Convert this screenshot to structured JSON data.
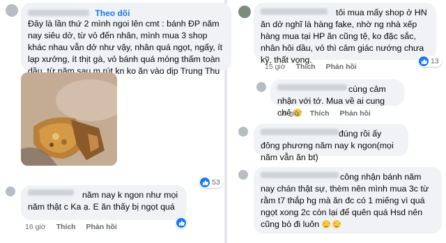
{
  "left": {
    "comment1": {
      "follow_label": "Theo dõi",
      "text": "Đây là lần thứ 2 mình ngoi lên cmt : bánh ĐP năm nay siêu dở, từ vỏ đến nhân, mình mua 3 shop khác nhau vẫn dở như vậy, nhân quá ngọt, ngấy, ít lạp xưởng, ít thịt gà, vỏ bánh quá mỏng thấm toàn dầu, từ năm sau m rút kn ko ăn vào dịp Trung Thu nữa",
      "reaction_count": "53",
      "photo_icon": "mooncake-photo"
    },
    "comment2": {
      "text": "năm nay k ngon như mọi năm thật c Ka ạ. E ăn thấy bị ngọt quá",
      "time": "16 giờ",
      "like_label": "Thích",
      "reply_label": "Phản hồi"
    }
  },
  "right": {
    "comment3": {
      "text": "tôi mua mấy shop ở HN ăn dở nghĩ là hàng fake, nhờ ng nhà xếp hàng mua tại HP ăn cũng tệ, ko đặc sắc, nhân hôi dầu, vỏ thì cảm giác nướng chưa kỹ, thất vọng.",
      "time": "15 giờ",
      "like_label": "Thích",
      "reply_label": "Phản hồi",
      "reaction_count": "13"
    },
    "comment4": {
      "text": "cùng cảm nhận với tớ. Mua về ai cung chê",
      "time": "16 giờ",
      "like_label": "Thích",
      "reply_label": "Phản hồi"
    },
    "comment5": {
      "text": "đúng rồi ấy đông phương năm nay k ngon(mọi năm vẫn ăn bt)"
    },
    "comment6": {
      "text": "công nhận bánh năm nay chán thật sự, thèm nên mình mua 3c từ rằm t7 thắp hg mà ăn đc có 1 miếng vì quá ngọt xong 2c còn lại để quên quá Hsd nên cũng bỏ đi luôn"
    }
  },
  "colors": {
    "bubble_bg": "#f0f2f5",
    "link_blue": "#1877f2",
    "meta_gray": "#65676b"
  }
}
